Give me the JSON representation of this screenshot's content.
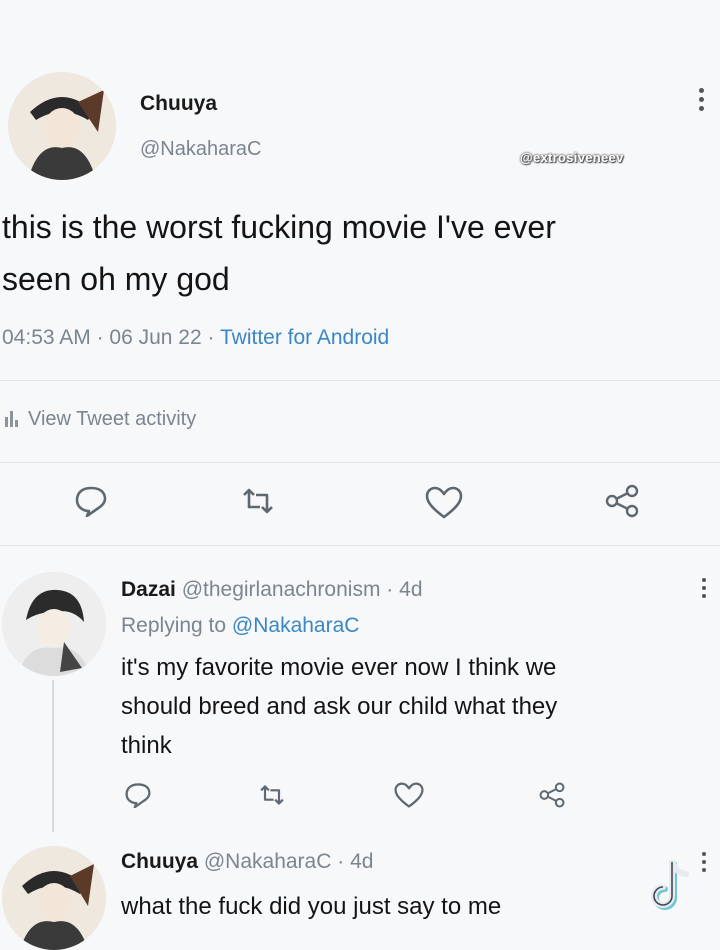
{
  "main_tweet": {
    "author": "Chuuya",
    "handle": "@NakaharaC",
    "watermark": "@extrosiveneev",
    "text_line1": "this is the worst fucking movie I've ever",
    "text_line2": "seen oh my god",
    "time": "04:53 AM",
    "date": "06 Jun 22",
    "source": "Twitter for Android",
    "activity_label": "View Tweet activity"
  },
  "reply1": {
    "author": "Dazai",
    "handle": "@thegirlanachronism",
    "age": "4d",
    "replying_prefix": "Replying to",
    "replying_handle": "@NakaharaC",
    "text_line1": "it's my favorite movie ever now I think we",
    "text_line2": "should breed and ask our child what they",
    "text_line3": "think"
  },
  "reply2": {
    "author": "Chuuya",
    "handle": "@NakaharaC",
    "age": "4d",
    "text": "what the fuck did you just say to me"
  },
  "icons": [
    "reply-icon",
    "retweet-icon",
    "like-icon",
    "share-icon",
    "more-icon",
    "tiktok-icon",
    "activity-icon"
  ]
}
